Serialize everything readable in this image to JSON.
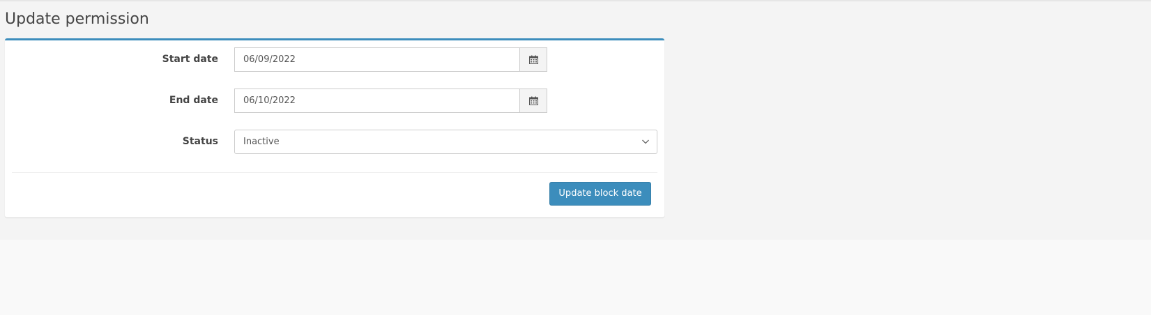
{
  "page": {
    "title": "Update permission"
  },
  "form": {
    "start_date": {
      "label": "Start date",
      "value": "06/09/2022",
      "icon": "calendar-icon"
    },
    "end_date": {
      "label": "End date",
      "value": "06/10/2022",
      "icon": "calendar-icon"
    },
    "status": {
      "label": "Status",
      "value": "Inactive",
      "icon": "chevron-down-icon"
    },
    "submit_label": "Update block date"
  },
  "colors": {
    "accent": "#3c8dbc",
    "page_background": "#f4f4f4",
    "box_background": "#ffffff"
  }
}
